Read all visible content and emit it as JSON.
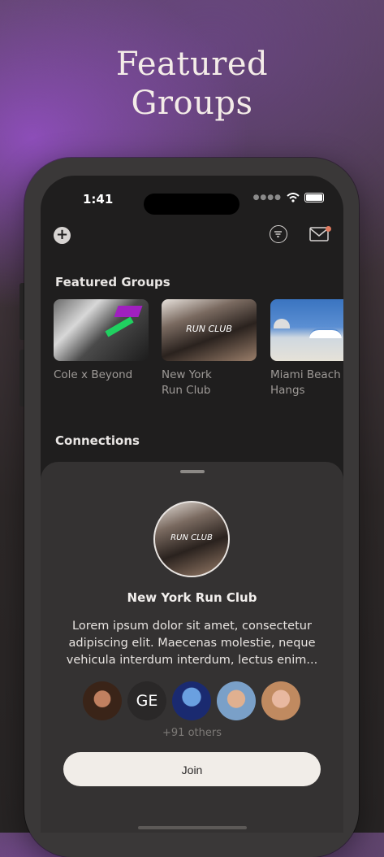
{
  "headline": {
    "line1": "Featured",
    "line2": "Groups"
  },
  "status": {
    "time": "1:41"
  },
  "sections": {
    "featured": "Featured Groups",
    "connections": "Connections"
  },
  "groups": [
    {
      "label": "Cole x Beyond"
    },
    {
      "label": "New York\nRun Club",
      "thumb_text": "RUN CLUB"
    },
    {
      "label": "Miami Beach\nHangs"
    }
  ],
  "sheet": {
    "avatar_text": "RUN CLUB",
    "name": "New York Run Club",
    "description": "Lorem ipsum dolor sit amet, consectetur adipiscing elit. Maecenas molestie, neque vehicula interdum interdum, lectus enim...",
    "member_initials": "GE",
    "others": "+91 others",
    "join_label": "Join"
  },
  "colors": {
    "accent_dot": "#e07a5f",
    "join_bg": "#f1ede8",
    "sheet_bg": "#343232"
  }
}
